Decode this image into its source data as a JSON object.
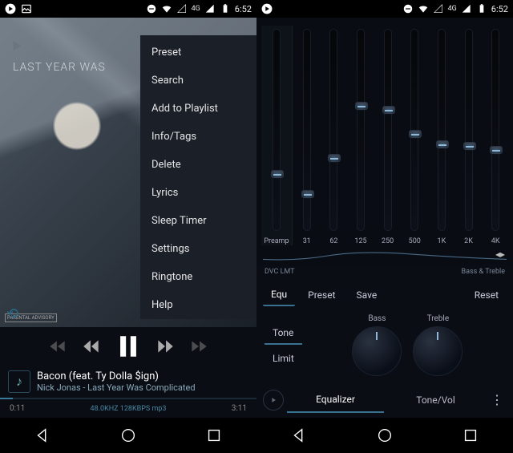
{
  "status": {
    "time": "6:52",
    "network_label": "4G"
  },
  "player": {
    "album_overlay_text": "LAST YEAR WAS",
    "parental_label": "PARENTAL ADVISORY",
    "track_title": "Bacon (feat. Ty Dolla $ign)",
    "track_subtitle": "Nick Jonas - Last Year Was Complicated",
    "time_current": "0:11",
    "time_total": "3:11",
    "audio_info": "48.0KHZ  128KBPS  mp3"
  },
  "menu": {
    "items": [
      "Preset",
      "Search",
      "Add to Playlist",
      "Info/Tags",
      "Delete",
      "Lyrics",
      "Sleep Timer",
      "Settings",
      "Ringtone",
      "Help"
    ]
  },
  "eq": {
    "bands": [
      {
        "label": "Preamp",
        "pos": 0.7
      },
      {
        "label": "31",
        "pos": 0.8
      },
      {
        "label": "62",
        "pos": 0.62
      },
      {
        "label": "125",
        "pos": 0.36
      },
      {
        "label": "250",
        "pos": 0.38
      },
      {
        "label": "500",
        "pos": 0.5
      },
      {
        "label": "1K",
        "pos": 0.55
      },
      {
        "label": "2K",
        "pos": 0.56
      },
      {
        "label": "4K",
        "pos": 0.58
      }
    ],
    "dvc_label": "DVC LMT",
    "bass_treble_label": "Bass & Treble",
    "buttons": {
      "equ": "Equ",
      "preset": "Preset",
      "save": "Save",
      "reset": "Reset",
      "tone": "Tone",
      "limit": "Limit"
    },
    "knobs": {
      "bass": "Bass",
      "treble": "Treble"
    },
    "tabs": {
      "equalizer": "Equalizer",
      "tonevol": "Tone/Vol"
    }
  }
}
